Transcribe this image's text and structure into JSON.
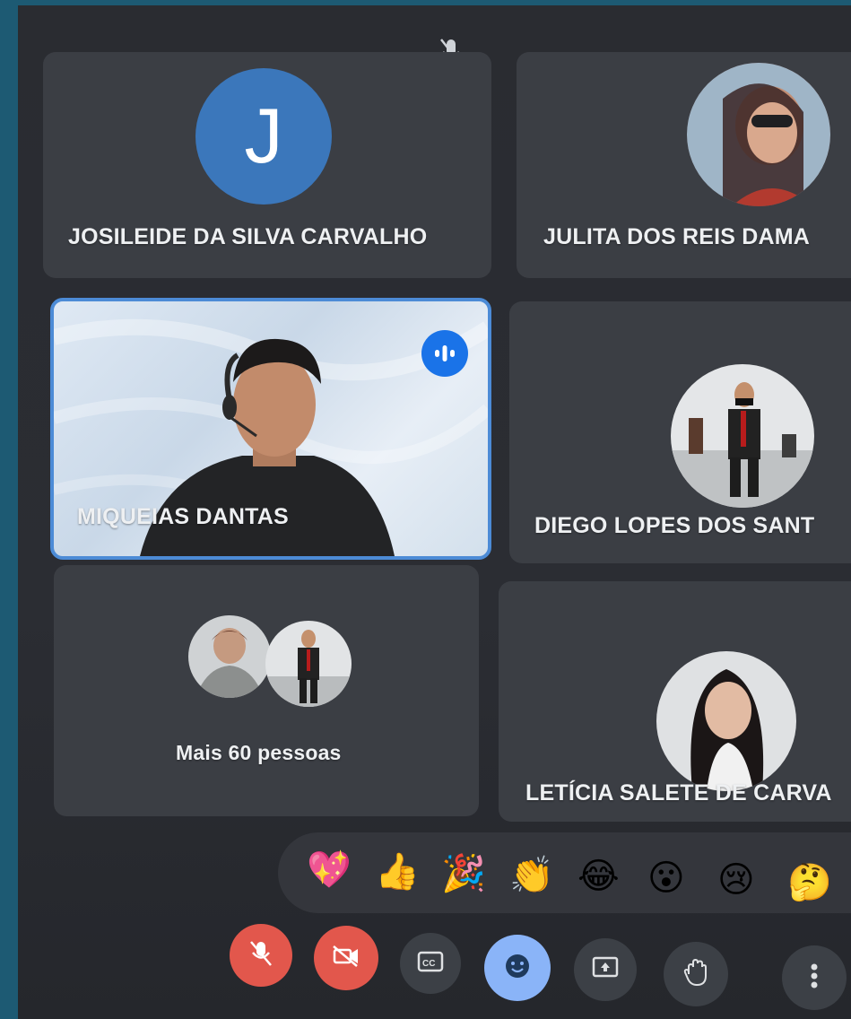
{
  "participants": [
    {
      "name": "JOSILEIDE DA SILVA CARVALHO",
      "avatar_letter": "J"
    },
    {
      "name": "JULITA DOS REIS DAMA"
    },
    {
      "name": "MIQUEIAS DANTAS",
      "speaking": true
    },
    {
      "name": "DIEGO LOPES DOS SANT"
    },
    {
      "name": "Mais 60 pessoas"
    },
    {
      "name": "LETÍCIA SALETE DE CARVA"
    }
  ],
  "reactions": [
    "💖",
    "👍",
    "🎉",
    "👏",
    "😂",
    "😮",
    "😢",
    "🤔"
  ],
  "controls": {
    "mic": "mic-off-icon",
    "camera": "camera-off-icon",
    "captions": "captions-icon",
    "emoji": "emoji-icon",
    "present": "present-screen-icon",
    "raise_hand": "raise-hand-icon",
    "more": "more-options-icon"
  },
  "colors": {
    "accent": "#1a73e8",
    "danger": "#e2574c",
    "avatar_blue": "#3b77bb"
  }
}
